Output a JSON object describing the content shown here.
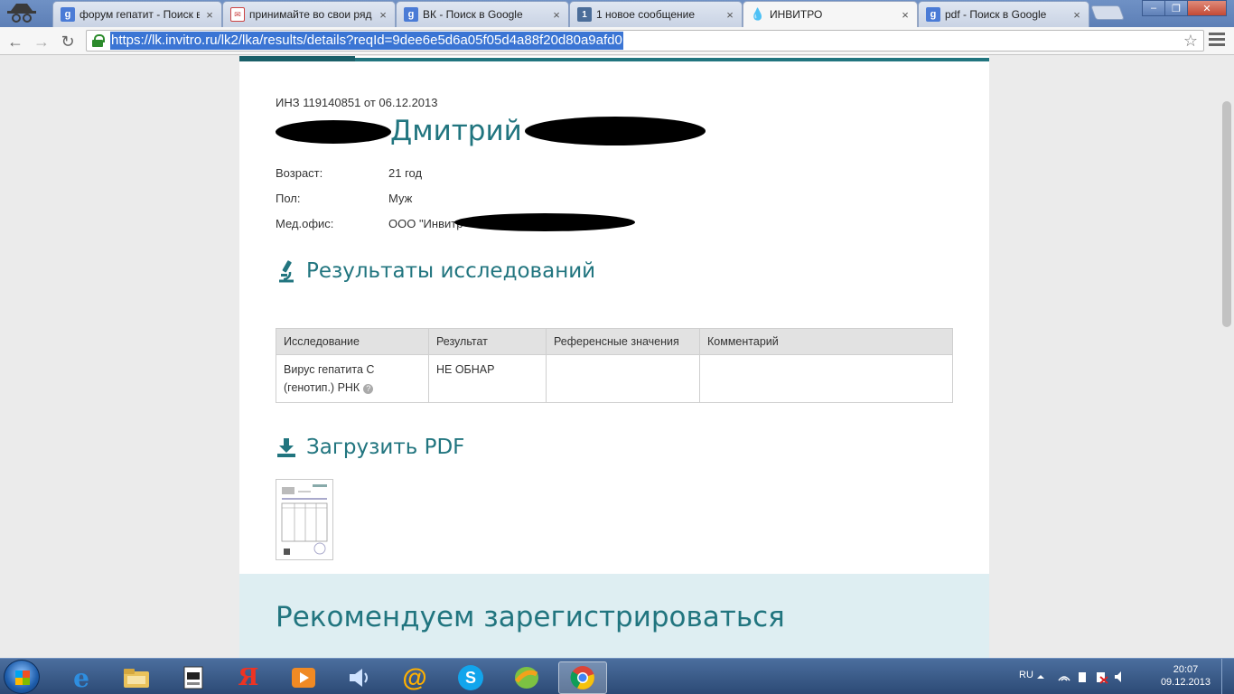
{
  "browser": {
    "tabs": [
      {
        "label": "форум гепатит - Поиск в",
        "favicon": "google-icon"
      },
      {
        "label": "принимайте во свои ряд",
        "favicon": "mail-icon"
      },
      {
        "label": "ВК - Поиск в Google",
        "favicon": "google-icon"
      },
      {
        "label": "1 новое сообщение",
        "favicon": "vk-icon"
      },
      {
        "label": "ИНВИТРО",
        "favicon": "invitro-drop-icon",
        "active": true
      },
      {
        "label": "pdf - Поиск в Google",
        "favicon": "google-icon"
      }
    ],
    "url": "https://lk.invitro.ru/lk2/lka/results/details?reqId=9dee6e5d6a05f05d4a88f20d80a9afd0",
    "tab_close_glyph": "×",
    "back_glyph": "←",
    "forward_glyph": "→",
    "reload_glyph": "↻",
    "star_glyph": "☆",
    "window_buttons": [
      "–",
      "❐",
      "✕"
    ]
  },
  "page": {
    "order_line": "ИНЗ 119140851 от 06.12.2013",
    "patient_first_name": "Дмитрий",
    "info": [
      {
        "key": "Возраст:",
        "value": "21 год"
      },
      {
        "key": "Пол:",
        "value": "Муж"
      },
      {
        "key": "Мед.офис:",
        "value": "ООО \"Инвитр"
      }
    ],
    "results_title": "Результаты исследований",
    "table": {
      "headers": [
        "Исследование",
        "Результат",
        "Референсные значения",
        "Комментарий"
      ],
      "rows": [
        {
          "test_line1": "Вирус гепатита С",
          "test_line2": "(генотип.) РНК",
          "result": "НЕ ОБНАР",
          "reference": "",
          "comment": ""
        }
      ]
    },
    "help_glyph": "?",
    "download_title": "Загрузить PDF",
    "recommend_title": "Рекомендуем зарегистрироваться"
  },
  "taskbar": {
    "apps": [
      "ie-icon",
      "explorer-icon",
      "app-icon",
      "yandex-icon",
      "media-player-icon",
      "volume-app-icon",
      "mail-agent-icon",
      "skype-icon",
      "app-icon-2",
      "chrome-icon"
    ],
    "yandex_glyph": "Я",
    "at_glyph": "@",
    "ie_glyph": "e",
    "skype_glyph": "S",
    "lang": "RU",
    "time": "20:07",
    "date": "09.12.2013"
  },
  "colors": {
    "accent": "#21757f",
    "recommend_bg": "#deeef2",
    "url_highlight": "#3b75d4"
  }
}
